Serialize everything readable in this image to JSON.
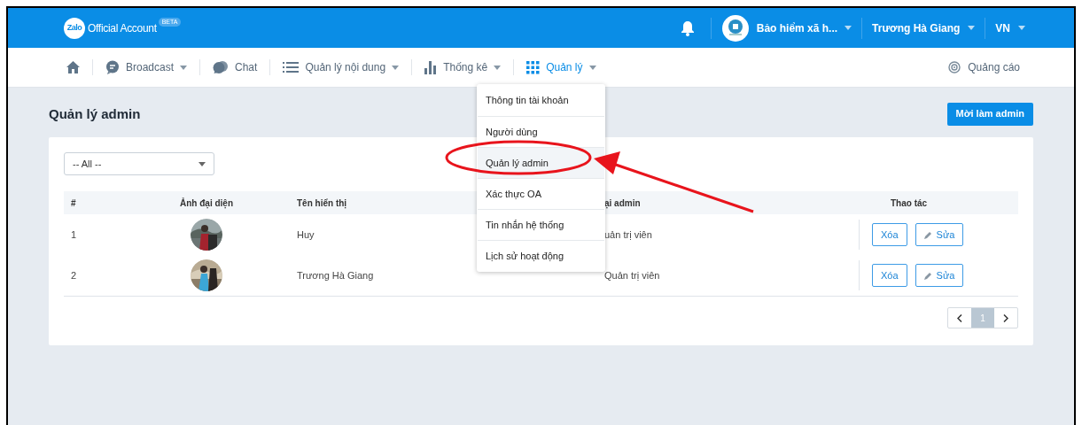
{
  "header": {
    "logo_text": "Zalo",
    "brand": "Official Account",
    "badge": "BETA",
    "account": "Bảo hiểm xã h...",
    "user": "Trương Hà Giang",
    "language": "VN"
  },
  "nav": {
    "items": [
      {
        "label": "Broadcast",
        "caret": true,
        "selected": false
      },
      {
        "label": "Chat",
        "caret": false,
        "selected": false
      },
      {
        "label": "Quản lý nội dung",
        "caret": true,
        "selected": false
      },
      {
        "label": "Thống kê",
        "caret": true,
        "selected": false
      },
      {
        "label": "Quản lý",
        "caret": true,
        "selected": true
      }
    ],
    "right": "Quảng cáo"
  },
  "page": {
    "title": "Quản lý admin",
    "invite_button": "Mời làm admin"
  },
  "filter": {
    "value": "-- All --"
  },
  "table": {
    "columns": [
      "#",
      "Ảnh đại diện",
      "Tên hiển thị",
      "ại admin",
      "Thao tác"
    ],
    "rows": [
      {
        "index": "1",
        "name": "Huy",
        "role": "uản trị viên",
        "actions": [
          "Xóa",
          "Sửa"
        ]
      },
      {
        "index": "2",
        "name": "Trương Hà Giang",
        "role": "Quản trị viên",
        "actions": [
          "Xóa",
          "Sửa"
        ]
      }
    ]
  },
  "pagination": {
    "pages": [
      {
        "label": "1",
        "selected": true
      }
    ]
  },
  "menu": {
    "items": [
      {
        "label": "Thông tin tài khoản",
        "selected": false
      },
      {
        "label": "Người dùng",
        "selected": false
      },
      {
        "label": "Quản lý admin",
        "selected": true
      },
      {
        "label": "Xác thực OA",
        "selected": false
      },
      {
        "label": "Tin nhắn hệ thống",
        "selected": false
      },
      {
        "label": "Lịch sử hoạt động",
        "selected": false
      }
    ]
  }
}
